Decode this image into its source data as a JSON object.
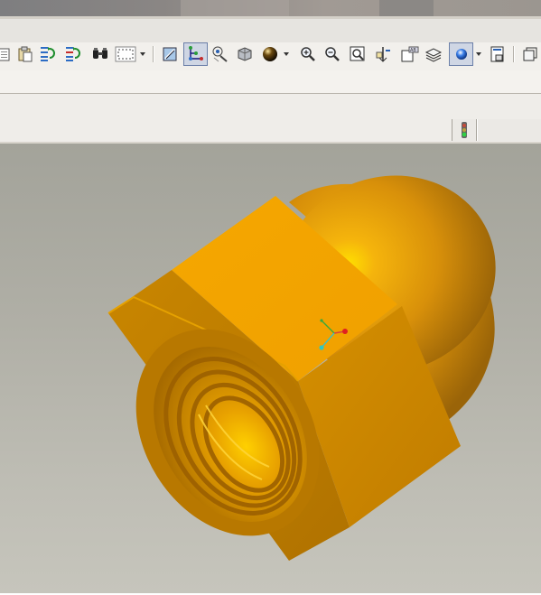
{
  "window": {
    "title": ""
  },
  "toolbar": {
    "buttons": [
      {
        "name": "paste-icon",
        "pressed": false
      },
      {
        "name": "paste-special-icon",
        "pressed": false
      },
      {
        "name": "regenerate-icon",
        "pressed": false
      },
      {
        "name": "regenerate-manager-icon",
        "pressed": false
      },
      {
        "name": "find-icon",
        "pressed": false
      },
      {
        "name": "select-box-icon",
        "pressed": false
      },
      {
        "name": "repaint-icon",
        "pressed": false
      },
      {
        "name": "spin-center-icon",
        "pressed": true
      },
      {
        "name": "orient-mode-icon",
        "pressed": false
      },
      {
        "name": "shading-icon",
        "pressed": false
      },
      {
        "name": "appearance-icon",
        "pressed": false
      },
      {
        "name": "zoom-in-icon",
        "pressed": false
      },
      {
        "name": "zoom-out-icon",
        "pressed": false
      },
      {
        "name": "refit-icon",
        "pressed": false
      },
      {
        "name": "reorient-icon",
        "pressed": false
      },
      {
        "name": "saved-views-icon",
        "pressed": false
      },
      {
        "name": "layers-icon",
        "pressed": false
      },
      {
        "name": "display-style-icon",
        "pressed": true
      },
      {
        "name": "model-tree-icon",
        "pressed": false
      },
      {
        "name": "views-icon",
        "pressed": false
      }
    ]
  },
  "status": {
    "traffic_light_icon": "traffic-light-icon"
  },
  "model": {
    "part": "acorn cap nut",
    "color": "#f0a800",
    "background_top": "#a3a39a",
    "background_bottom": "#c6c5bc"
  }
}
